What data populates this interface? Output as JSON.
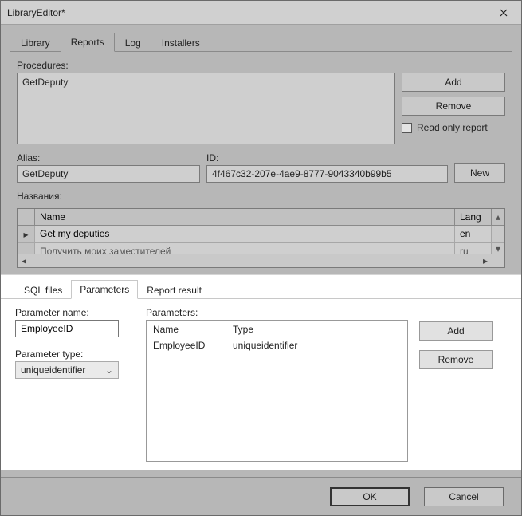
{
  "window": {
    "title": "LibraryEditor*"
  },
  "tabs": {
    "library": "Library",
    "reports": "Reports",
    "log": "Log",
    "installers": "Installers"
  },
  "procedures": {
    "label": "Procedures:",
    "items": [
      "GetDeputy"
    ],
    "add": "Add",
    "remove": "Remove",
    "readonly_label": "Read only report"
  },
  "alias": {
    "label": "Alias:",
    "value": "GetDeputy"
  },
  "id": {
    "label": "ID:",
    "value": "4f467c32-207e-4ae9-8777-9043340b99b5"
  },
  "new_btn": "New",
  "names": {
    "label": "Названия:",
    "col_name": "Name",
    "col_lang": "Lang",
    "rows": [
      {
        "name": "Get my deputies",
        "lang": "en"
      },
      {
        "name": "Получить моих заместителей",
        "lang": "ru"
      }
    ]
  },
  "inner_tabs": {
    "sql": "SQL files",
    "parameters": "Parameters",
    "result": "Report result"
  },
  "param_form": {
    "name_label": "Parameter name:",
    "name_value": "EmployeeID",
    "type_label": "Parameter type:",
    "type_value": "uniqueidentifier"
  },
  "param_list": {
    "label": "Parameters:",
    "col_name": "Name",
    "col_type": "Type",
    "rows": [
      {
        "name": "EmployeeID",
        "type": "uniqueidentifier"
      }
    ],
    "add": "Add",
    "remove": "Remove"
  },
  "footer": {
    "ok": "OK",
    "cancel": "Cancel"
  }
}
